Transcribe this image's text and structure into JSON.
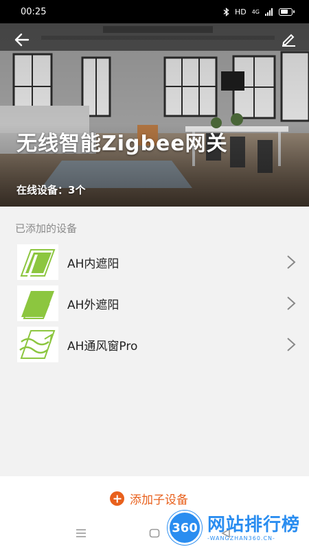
{
  "status_bar": {
    "time": "00:25",
    "bluetooth_icon": "bluetooth-icon",
    "network": "HD",
    "signal_label": "4G",
    "battery_level": 0.75
  },
  "header": {
    "back_icon": "arrow-left-icon",
    "edit_icon": "pencil-icon",
    "title": "无线智能Zigbee网关",
    "online_label": "在线设备：3个"
  },
  "section": {
    "title": "已添加的设备"
  },
  "devices": [
    {
      "label": "AH内遮阳",
      "icon": "inner-shade-icon"
    },
    {
      "label": "AH外遮阳",
      "icon": "outer-shade-icon"
    },
    {
      "label": "AH通风窗Pro",
      "icon": "ventilation-window-icon"
    }
  ],
  "footer": {
    "add_label": "添加子设备",
    "add_icon": "plus-circle-icon"
  },
  "nav": {
    "menu_icon": "menu-icon",
    "home_icon": "home-icon",
    "back_icon": "back-triangle-icon"
  },
  "watermark": {
    "badge": "360",
    "main": "网站排行榜",
    "sub": "-WANGZHAN360.CN-"
  },
  "colors": {
    "accent": "#e8601c",
    "icon_green": "#8cc63f",
    "watermark_blue": "#2a8df0"
  }
}
